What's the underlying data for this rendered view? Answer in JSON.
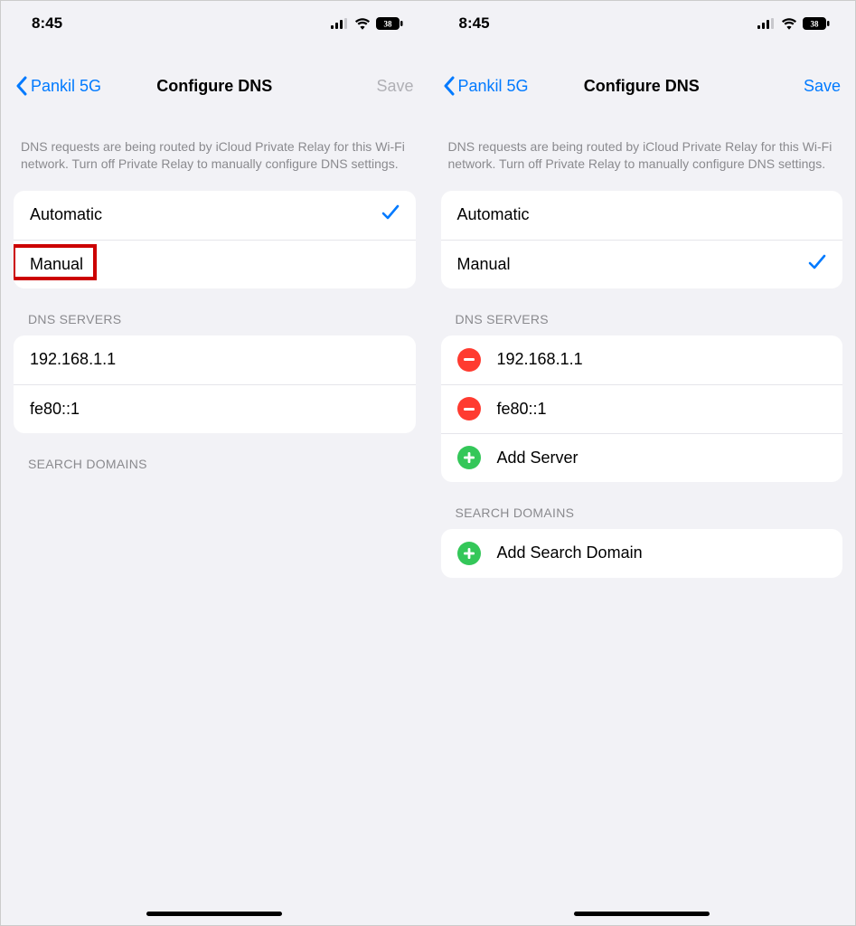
{
  "status": {
    "time": "8:45",
    "battery_pct": "38"
  },
  "nav": {
    "back_label": "Pankil 5G",
    "title": "Configure DNS",
    "save_label": "Save"
  },
  "info_text": "DNS requests are being routed by iCloud Private Relay for this Wi-Fi network. Turn off Private Relay to manually configure DNS settings.",
  "options": {
    "automatic": "Automatic",
    "manual": "Manual"
  },
  "sections": {
    "dns_servers": "DNS SERVERS",
    "search_domains": "SEARCH DOMAINS"
  },
  "servers": [
    "192.168.1.1",
    "fe80::1"
  ],
  "actions": {
    "add_server": "Add Server",
    "add_search_domain": "Add Search Domain"
  }
}
